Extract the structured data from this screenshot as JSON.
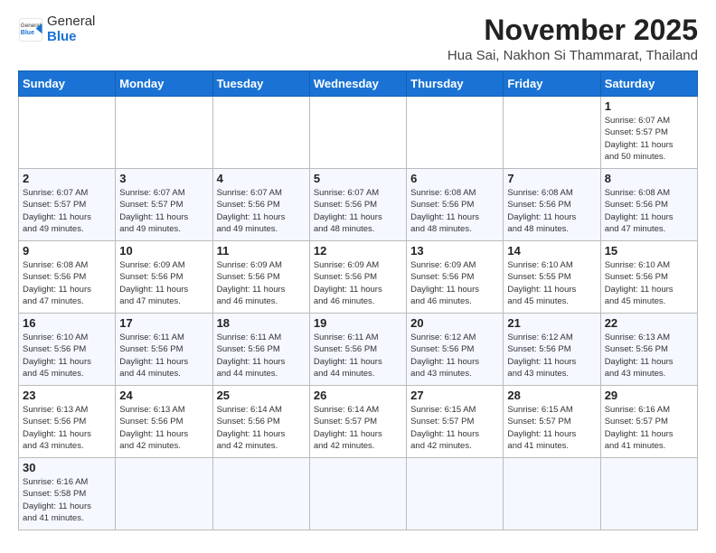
{
  "header": {
    "logo_general": "General",
    "logo_blue": "Blue",
    "month_title": "November 2025",
    "location": "Hua Sai, Nakhon Si Thammarat, Thailand"
  },
  "weekdays": [
    "Sunday",
    "Monday",
    "Tuesday",
    "Wednesday",
    "Thursday",
    "Friday",
    "Saturday"
  ],
  "days": [
    {
      "num": "",
      "info": ""
    },
    {
      "num": "",
      "info": ""
    },
    {
      "num": "",
      "info": ""
    },
    {
      "num": "",
      "info": ""
    },
    {
      "num": "",
      "info": ""
    },
    {
      "num": "",
      "info": ""
    },
    {
      "num": "1",
      "info": "Sunrise: 6:07 AM\nSunset: 5:57 PM\nDaylight: 11 hours\nand 50 minutes."
    },
    {
      "num": "2",
      "info": "Sunrise: 6:07 AM\nSunset: 5:57 PM\nDaylight: 11 hours\nand 49 minutes."
    },
    {
      "num": "3",
      "info": "Sunrise: 6:07 AM\nSunset: 5:57 PM\nDaylight: 11 hours\nand 49 minutes."
    },
    {
      "num": "4",
      "info": "Sunrise: 6:07 AM\nSunset: 5:56 PM\nDaylight: 11 hours\nand 49 minutes."
    },
    {
      "num": "5",
      "info": "Sunrise: 6:07 AM\nSunset: 5:56 PM\nDaylight: 11 hours\nand 48 minutes."
    },
    {
      "num": "6",
      "info": "Sunrise: 6:08 AM\nSunset: 5:56 PM\nDaylight: 11 hours\nand 48 minutes."
    },
    {
      "num": "7",
      "info": "Sunrise: 6:08 AM\nSunset: 5:56 PM\nDaylight: 11 hours\nand 48 minutes."
    },
    {
      "num": "8",
      "info": "Sunrise: 6:08 AM\nSunset: 5:56 PM\nDaylight: 11 hours\nand 47 minutes."
    },
    {
      "num": "9",
      "info": "Sunrise: 6:08 AM\nSunset: 5:56 PM\nDaylight: 11 hours\nand 47 minutes."
    },
    {
      "num": "10",
      "info": "Sunrise: 6:09 AM\nSunset: 5:56 PM\nDaylight: 11 hours\nand 47 minutes."
    },
    {
      "num": "11",
      "info": "Sunrise: 6:09 AM\nSunset: 5:56 PM\nDaylight: 11 hours\nand 46 minutes."
    },
    {
      "num": "12",
      "info": "Sunrise: 6:09 AM\nSunset: 5:56 PM\nDaylight: 11 hours\nand 46 minutes."
    },
    {
      "num": "13",
      "info": "Sunrise: 6:09 AM\nSunset: 5:56 PM\nDaylight: 11 hours\nand 46 minutes."
    },
    {
      "num": "14",
      "info": "Sunrise: 6:10 AM\nSunset: 5:55 PM\nDaylight: 11 hours\nand 45 minutes."
    },
    {
      "num": "15",
      "info": "Sunrise: 6:10 AM\nSunset: 5:56 PM\nDaylight: 11 hours\nand 45 minutes."
    },
    {
      "num": "16",
      "info": "Sunrise: 6:10 AM\nSunset: 5:56 PM\nDaylight: 11 hours\nand 45 minutes."
    },
    {
      "num": "17",
      "info": "Sunrise: 6:11 AM\nSunset: 5:56 PM\nDaylight: 11 hours\nand 44 minutes."
    },
    {
      "num": "18",
      "info": "Sunrise: 6:11 AM\nSunset: 5:56 PM\nDaylight: 11 hours\nand 44 minutes."
    },
    {
      "num": "19",
      "info": "Sunrise: 6:11 AM\nSunset: 5:56 PM\nDaylight: 11 hours\nand 44 minutes."
    },
    {
      "num": "20",
      "info": "Sunrise: 6:12 AM\nSunset: 5:56 PM\nDaylight: 11 hours\nand 43 minutes."
    },
    {
      "num": "21",
      "info": "Sunrise: 6:12 AM\nSunset: 5:56 PM\nDaylight: 11 hours\nand 43 minutes."
    },
    {
      "num": "22",
      "info": "Sunrise: 6:13 AM\nSunset: 5:56 PM\nDaylight: 11 hours\nand 43 minutes."
    },
    {
      "num": "23",
      "info": "Sunrise: 6:13 AM\nSunset: 5:56 PM\nDaylight: 11 hours\nand 43 minutes."
    },
    {
      "num": "24",
      "info": "Sunrise: 6:13 AM\nSunset: 5:56 PM\nDaylight: 11 hours\nand 42 minutes."
    },
    {
      "num": "25",
      "info": "Sunrise: 6:14 AM\nSunset: 5:56 PM\nDaylight: 11 hours\nand 42 minutes."
    },
    {
      "num": "26",
      "info": "Sunrise: 6:14 AM\nSunset: 5:57 PM\nDaylight: 11 hours\nand 42 minutes."
    },
    {
      "num": "27",
      "info": "Sunrise: 6:15 AM\nSunset: 5:57 PM\nDaylight: 11 hours\nand 42 minutes."
    },
    {
      "num": "28",
      "info": "Sunrise: 6:15 AM\nSunset: 5:57 PM\nDaylight: 11 hours\nand 41 minutes."
    },
    {
      "num": "29",
      "info": "Sunrise: 6:16 AM\nSunset: 5:57 PM\nDaylight: 11 hours\nand 41 minutes."
    },
    {
      "num": "30",
      "info": "Sunrise: 6:16 AM\nSunset: 5:58 PM\nDaylight: 11 hours\nand 41 minutes."
    },
    {
      "num": "",
      "info": ""
    },
    {
      "num": "",
      "info": ""
    },
    {
      "num": "",
      "info": ""
    },
    {
      "num": "",
      "info": ""
    },
    {
      "num": "",
      "info": ""
    },
    {
      "num": "",
      "info": ""
    }
  ]
}
